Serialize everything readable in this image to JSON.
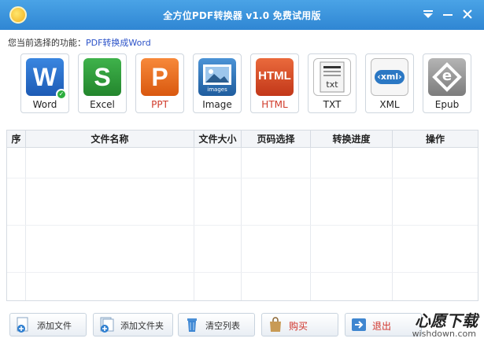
{
  "window": {
    "title": "全方位PDF转换器 v1.0 免费试用版",
    "menu_icon": "chevron-down-icon",
    "minimize_icon": "minimize-icon",
    "close_icon": "close-icon"
  },
  "function_line": {
    "label": "您当前选择的功能：",
    "value": "PDF转换成Word"
  },
  "formats": [
    {
      "label": "Word",
      "glyph": "W",
      "color": "#2468c8",
      "selected": true
    },
    {
      "label": "Excel",
      "glyph": "S",
      "color": "#2f9a3a",
      "selected": false
    },
    {
      "label": "PPT",
      "glyph": "P",
      "color": "#e86a1c",
      "selected": false
    },
    {
      "label": "Image",
      "glyph": "images",
      "color": "#2a6fb3",
      "selected": false
    },
    {
      "label": "HTML",
      "glyph": "HTML",
      "color": "#d9472b",
      "selected": false
    },
    {
      "label": "TXT",
      "glyph": "txt",
      "color": "#9a9a9a",
      "selected": false
    },
    {
      "label": "XML",
      "glyph": "‹xml›",
      "color": "#2b78c4",
      "selected": false
    },
    {
      "label": "Epub",
      "glyph": "e",
      "color": "#8a8a8a",
      "selected": false
    }
  ],
  "table": {
    "headers": [
      "序号",
      "文件名称",
      "文件大小",
      "页码选择",
      "转换进度",
      "操作"
    ]
  },
  "bottom_buttons": [
    {
      "label": "添加文件",
      "icon": "add-file-icon"
    },
    {
      "label": "添加文件夹",
      "icon": "add-folder-icon"
    },
    {
      "label": "清空列表",
      "icon": "trash-icon"
    },
    {
      "label": "购买",
      "icon": "shopping-bag-icon"
    },
    {
      "label": "退出",
      "icon": "exit-arrow-icon"
    }
  ],
  "watermark": {
    "main": "心愿下载",
    "sub": "wishdown.com"
  }
}
